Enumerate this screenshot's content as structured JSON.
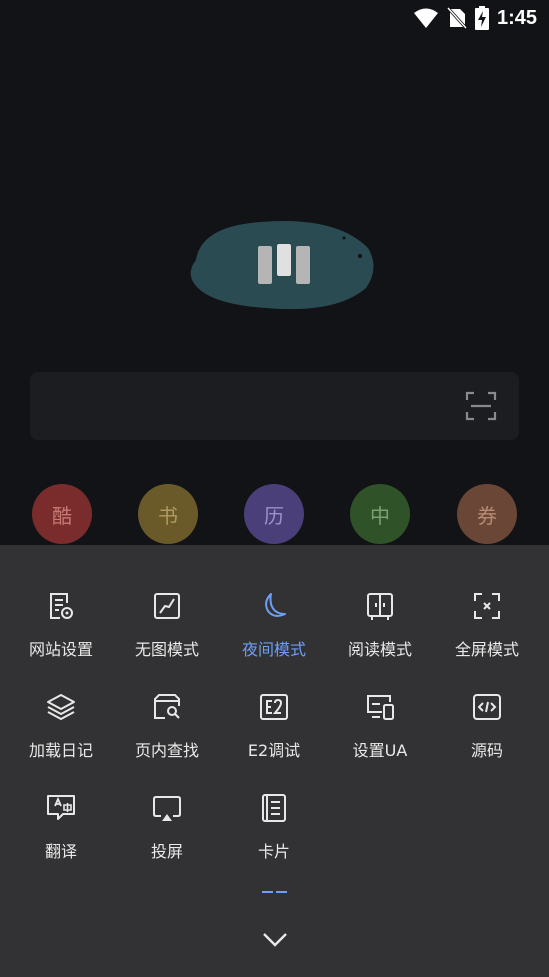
{
  "status_bar": {
    "time": "1:45"
  },
  "search": {
    "placeholder": ""
  },
  "quick_links": [
    {
      "char": "酷",
      "color": "#7a2b2b",
      "text_color": "#c47a74"
    },
    {
      "char": "书",
      "color": "#6a5a2a",
      "text_color": "#b29a5e"
    },
    {
      "char": "历",
      "color": "#4a3f78",
      "text_color": "#9d8fcb"
    },
    {
      "char": "中",
      "color": "#2f5228",
      "text_color": "#7aa16e"
    },
    {
      "char": "券",
      "color": "#6a4636",
      "text_color": "#b88b72"
    }
  ],
  "menu": {
    "items": [
      {
        "label": "网站设置",
        "icon": "site-settings-icon"
      },
      {
        "label": "无图模式",
        "icon": "no-image-icon"
      },
      {
        "label": "夜间模式",
        "icon": "moon-icon",
        "active": true
      },
      {
        "label": "阅读模式",
        "icon": "reader-icon"
      },
      {
        "label": "全屏模式",
        "icon": "fullscreen-icon"
      },
      {
        "label": "加载日记",
        "icon": "layers-icon"
      },
      {
        "label": "页内查找",
        "icon": "find-in-page-icon"
      },
      {
        "label": "E2调试",
        "icon": "e2-icon"
      },
      {
        "label": "设置UA",
        "icon": "devices-icon"
      },
      {
        "label": "源码",
        "icon": "code-icon"
      },
      {
        "label": "翻译",
        "icon": "translate-icon"
      },
      {
        "label": "投屏",
        "icon": "cast-icon"
      },
      {
        "label": "卡片",
        "icon": "card-icon"
      }
    ]
  },
  "colors": {
    "accent": "#6f9ef5",
    "sheet_bg": "#323234",
    "page_bg": "#121316"
  }
}
